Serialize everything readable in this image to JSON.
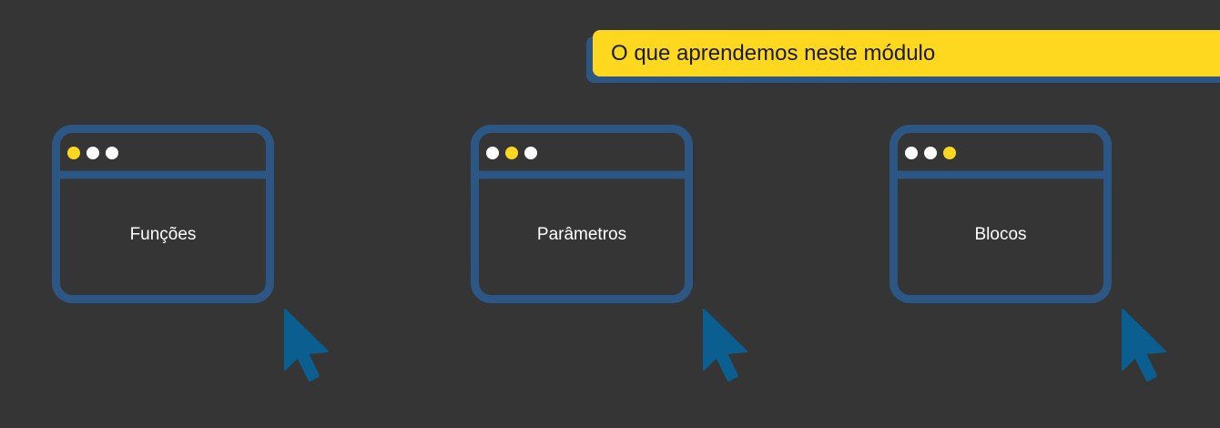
{
  "banner": {
    "title": "O que aprendemos neste módulo"
  },
  "colors": {
    "background": "#353535",
    "banner_yellow": "#fdd81e",
    "frame_blue": "#2c5784",
    "cursor_blue": "#0a5f90",
    "dot_active": "#fdd81e",
    "dot_inactive": "#ffffff"
  },
  "cards": [
    {
      "label": "Funções",
      "active_dot": 1
    },
    {
      "label": "Parâmetros",
      "active_dot": 2
    },
    {
      "label": "Blocos",
      "active_dot": 3
    }
  ],
  "icons": {
    "window": "browser-window-icon",
    "cursor": "mouse-pointer-icon"
  }
}
